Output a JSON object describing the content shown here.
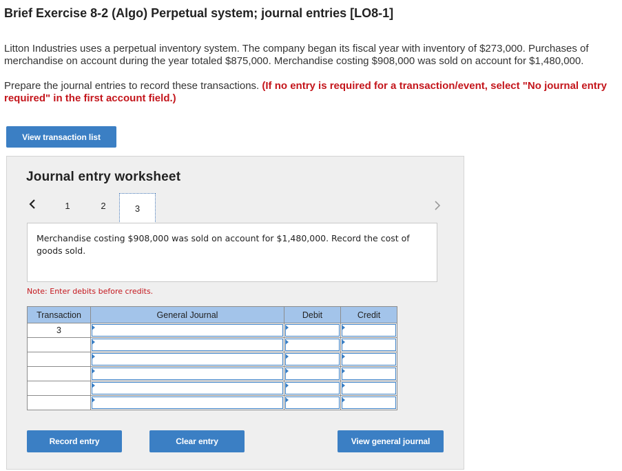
{
  "header": {
    "title": "Brief Exercise 8-2 (Algo) Perpetual system; journal entries [LO8-1]"
  },
  "intro": "Litton Industries uses a perpetual inventory system. The company began its fiscal year with inventory of $273,000. Purchases of merchandise on account during the year totaled $875,000. Merchandise costing $908,000 was sold on account for $1,480,000.",
  "instructions": {
    "text": "Prepare the journal entries to record these transactions. ",
    "emphasis": "(If no entry is required for a transaction/event, select \"No journal entry required\" in the first account field.)"
  },
  "buttons": {
    "view_transaction_list": "View transaction list",
    "record_entry": "Record entry",
    "clear_entry": "Clear entry",
    "view_general_journal": "View general journal"
  },
  "worksheet": {
    "title": "Journal entry worksheet",
    "pages": [
      "1",
      "2",
      "3"
    ],
    "current_page": "3",
    "description": "Merchandise costing $908,000 was sold on account for $1,480,000. Record the cost of goods sold.",
    "note": "Note: Enter debits before credits."
  },
  "table": {
    "headers": {
      "transaction": "Transaction",
      "general_journal": "General Journal",
      "debit": "Debit",
      "credit": "Credit"
    },
    "rows": [
      {
        "transaction": "3",
        "account": "",
        "debit": "",
        "credit": ""
      },
      {
        "transaction": "",
        "account": "",
        "debit": "",
        "credit": ""
      },
      {
        "transaction": "",
        "account": "",
        "debit": "",
        "credit": ""
      },
      {
        "transaction": "",
        "account": "",
        "debit": "",
        "credit": ""
      },
      {
        "transaction": "",
        "account": "",
        "debit": "",
        "credit": ""
      },
      {
        "transaction": "",
        "account": "",
        "debit": "",
        "credit": ""
      }
    ]
  },
  "icons": {
    "prev": "chevron-left-icon",
    "next": "chevron-right-icon"
  },
  "colors": {
    "button_blue": "#3b7fc4",
    "header_blue": "#a3c4ea",
    "emphasis_red": "#c4161c"
  }
}
